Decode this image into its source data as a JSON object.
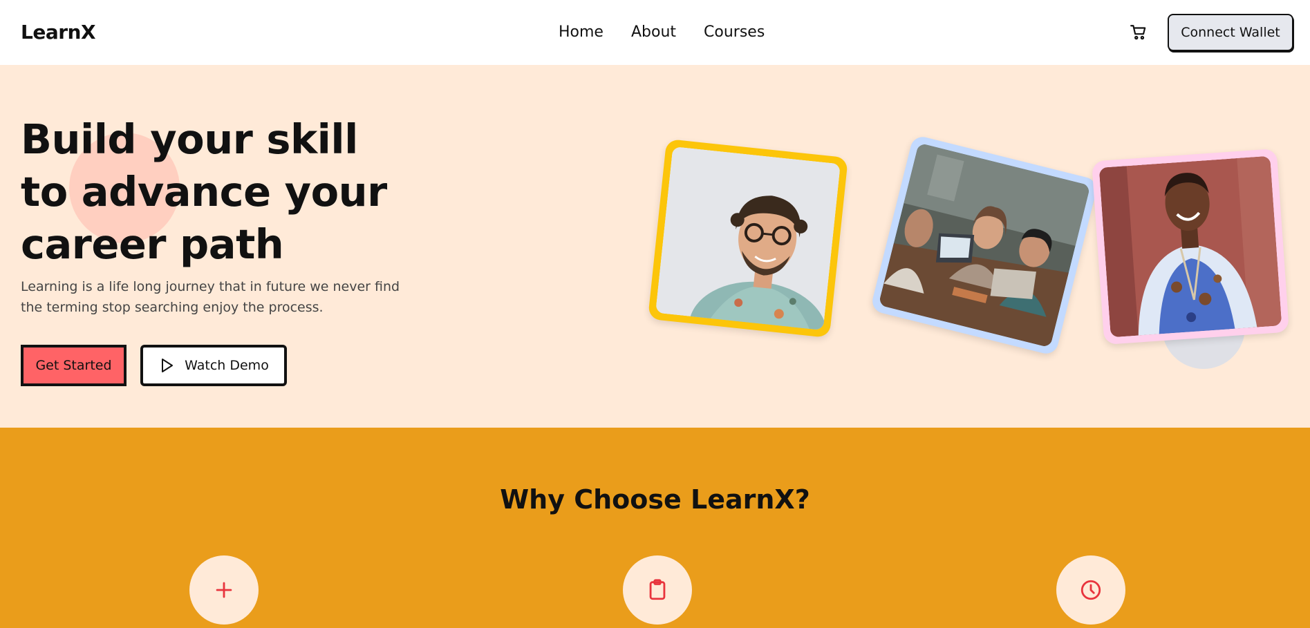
{
  "navbar": {
    "logo": "LearnX",
    "links": [
      "Home",
      "About",
      "Courses"
    ],
    "cart_icon": "cart-icon",
    "wallet_button": "Connect Wallet"
  },
  "hero": {
    "title_lines": [
      "Build your skill",
      "to advance your",
      "career path"
    ],
    "subtitle": "Learning is a life long journey that in future we never find the terming stop searching enjoy the process.",
    "primary_button": "Get Started",
    "secondary_button": "Watch Demo",
    "secondary_button_icon": "play-icon",
    "photos": [
      {
        "name": "man-portrait-photo",
        "frame_color": "#fcc50a"
      },
      {
        "name": "group-study-photo",
        "frame_color": "#c3daff"
      },
      {
        "name": "woman-portrait-photo",
        "frame_color": "#ffd0ec"
      }
    ]
  },
  "features": {
    "title": "Why Choose LearnX?",
    "icons": [
      "plus-icon",
      "clipboard-icon",
      "clock-icon"
    ]
  },
  "colors": {
    "hero_bg": "#ffead8",
    "features_bg": "#ea9d1b",
    "primary_button": "#ff6366",
    "icon_red": "#e8343d"
  }
}
